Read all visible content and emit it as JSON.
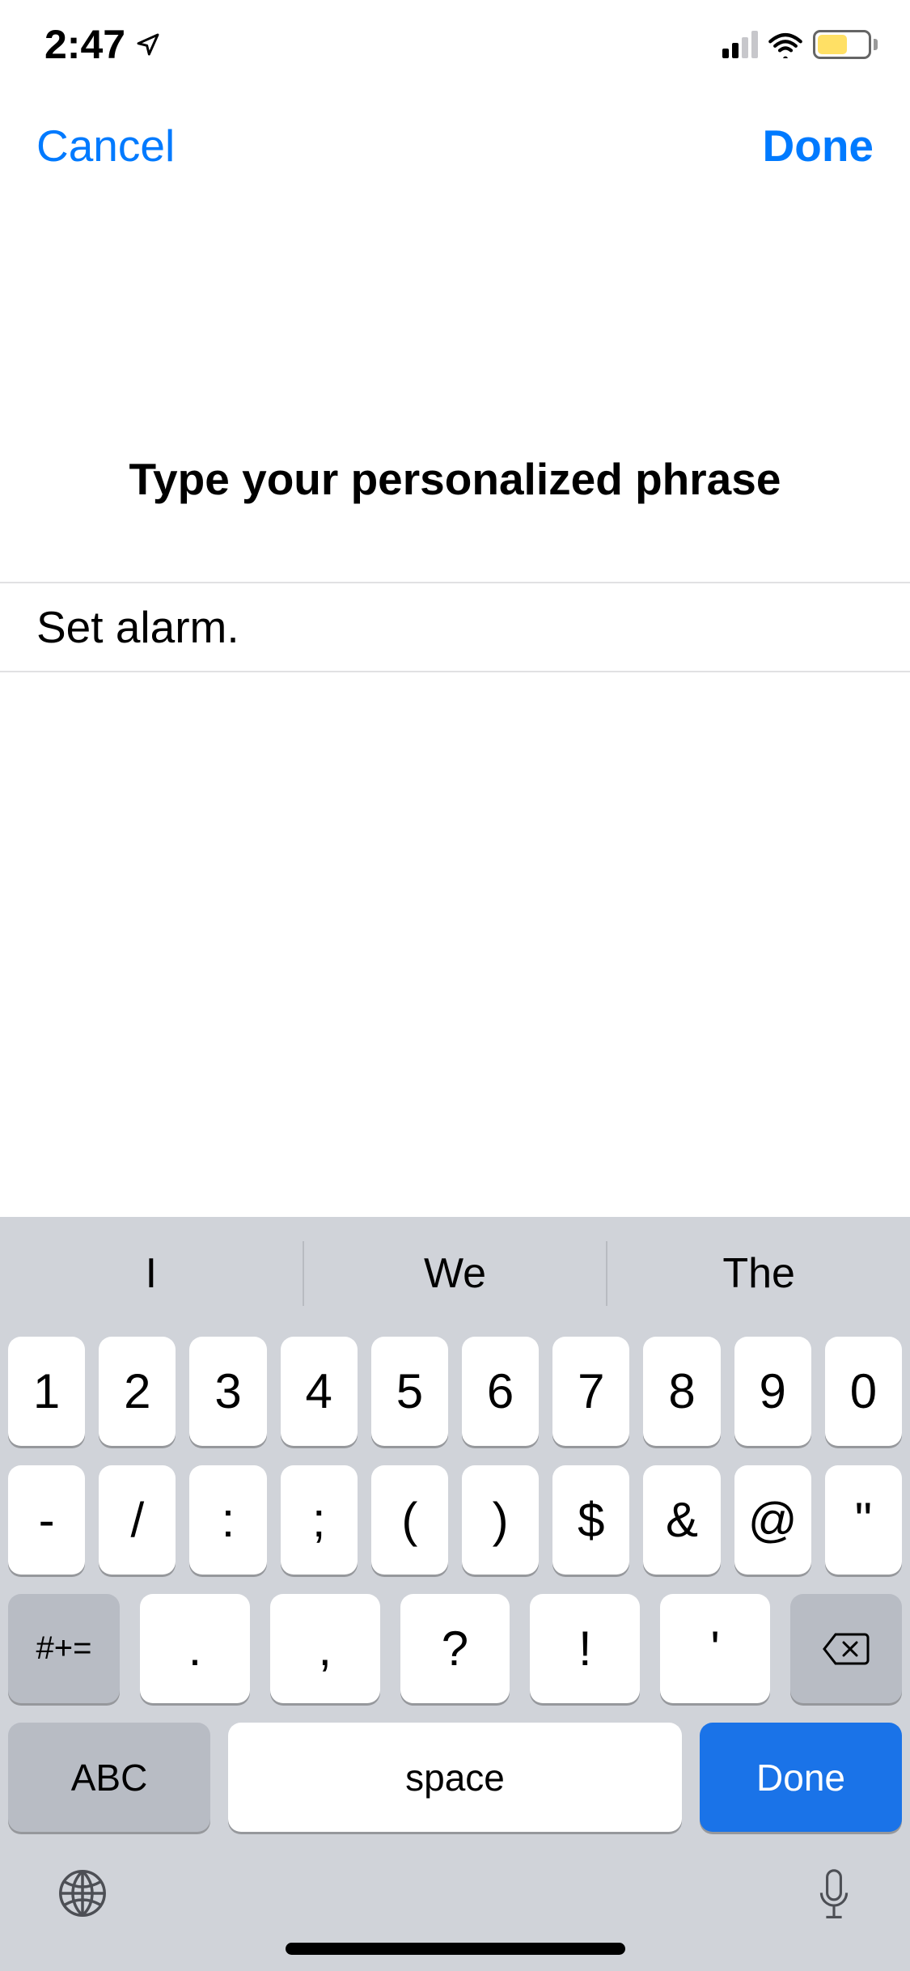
{
  "status": {
    "time": "2:47",
    "location_icon": "location-arrow",
    "signal_strength": 2,
    "battery_level": 0.55,
    "battery_color": "#ffcc00"
  },
  "nav": {
    "left": "Cancel",
    "right": "Done"
  },
  "prompt": "Type your personalized phrase",
  "input": {
    "value": "Set alarm."
  },
  "keyboard": {
    "suggestions": [
      "I",
      "We",
      "The"
    ],
    "row1": [
      "1",
      "2",
      "3",
      "4",
      "5",
      "6",
      "7",
      "8",
      "9",
      "0"
    ],
    "row2": [
      "-",
      "/",
      ":",
      ";",
      "(",
      ")",
      "$",
      "&",
      "@",
      "\""
    ],
    "shift_label": "#+=",
    "row3": [
      ".",
      ",",
      "?",
      "!",
      "'"
    ],
    "backspace_icon": "backspace",
    "abc_label": "ABC",
    "space_label": "space",
    "return_label": "Done",
    "globe_icon": "globe",
    "mic_icon": "microphone"
  },
  "colors": {
    "accent": "#007aff",
    "keyboard_bg": "#d0d3d9",
    "done_key": "#1a73e8"
  }
}
